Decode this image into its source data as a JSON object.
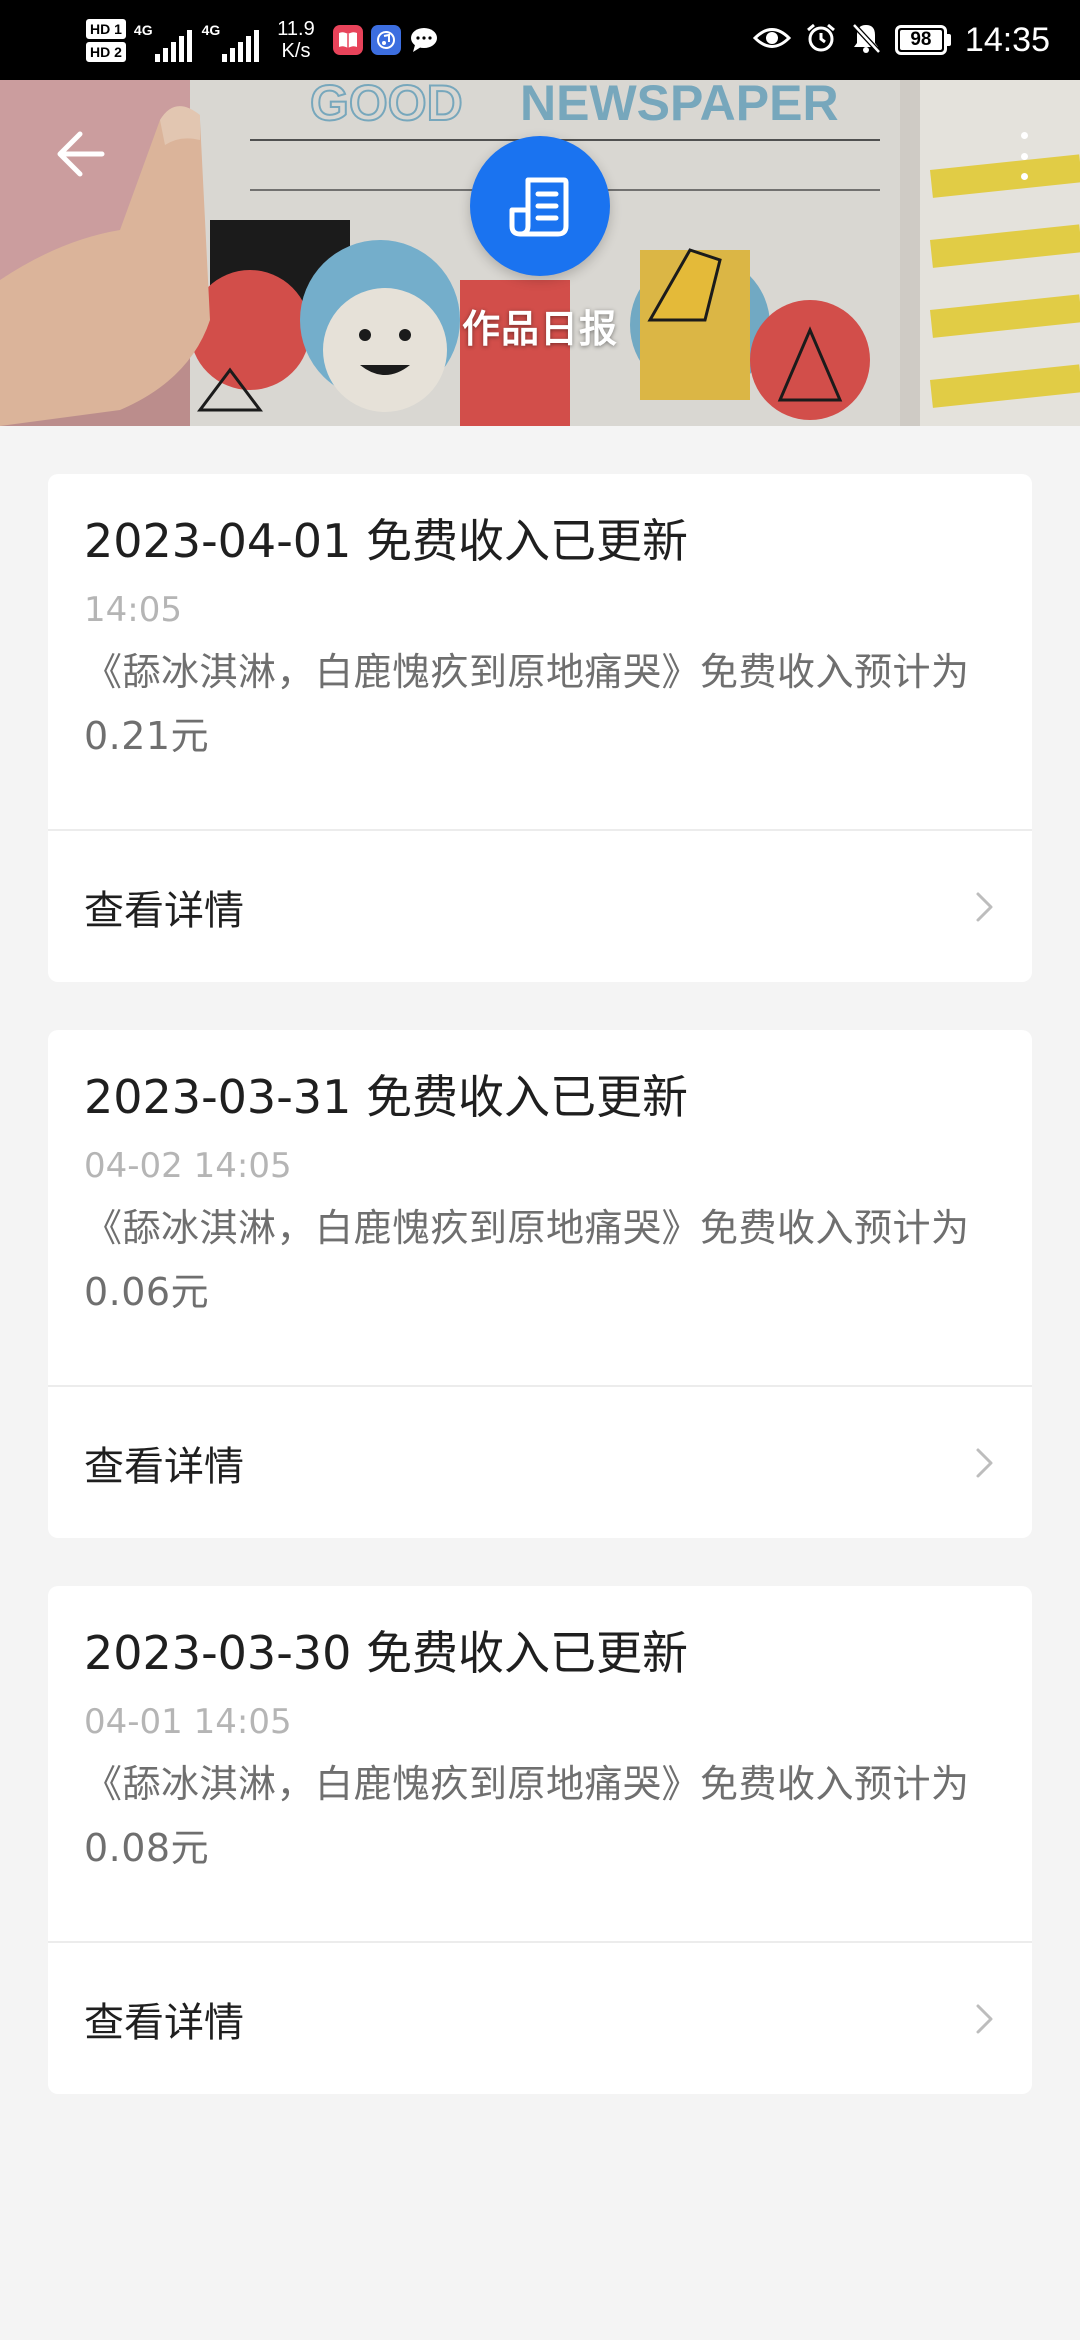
{
  "status_bar": {
    "hd1": "HD 1",
    "hd2": "HD 2",
    "network1": "4G",
    "network2": "4G",
    "speed_value": "11.9",
    "speed_unit": "K/s",
    "battery": "98",
    "time": "14:35",
    "icons": [
      "book-app-icon",
      "music-app-icon",
      "message-icon",
      "eye-icon",
      "alarm-icon",
      "mute-icon"
    ]
  },
  "header": {
    "title": "作品日报",
    "banner_text": "NEWSPAPER",
    "back_icon": "back-arrow-icon",
    "more_icon": "more-vertical-icon",
    "logo_icon": "newspaper-icon"
  },
  "reports": [
    {
      "title": "2023-04-01 免费收入已更新",
      "time": "14:05",
      "description": "《舔冰淇淋，白鹿愧疚到原地痛哭》免费收入预计为0.21元",
      "action": "查看详情"
    },
    {
      "title": "2023-03-31 免费收入已更新",
      "time": "04-02 14:05",
      "description": "《舔冰淇淋，白鹿愧疚到原地痛哭》免费收入预计为0.06元",
      "action": "查看详情"
    },
    {
      "title": "2023-03-30 免费收入已更新",
      "time": "04-01 14:05",
      "description": "《舔冰淇淋，白鹿愧疚到原地痛哭》免费收入预计为0.08元",
      "action": "查看详情"
    }
  ],
  "colors": {
    "accent": "#1a73f0",
    "background": "#f4f4f4",
    "card": "#ffffff",
    "title_text": "#1f1f1f",
    "secondary_text": "#6f6f6f",
    "muted_text": "#b5b5b5"
  }
}
